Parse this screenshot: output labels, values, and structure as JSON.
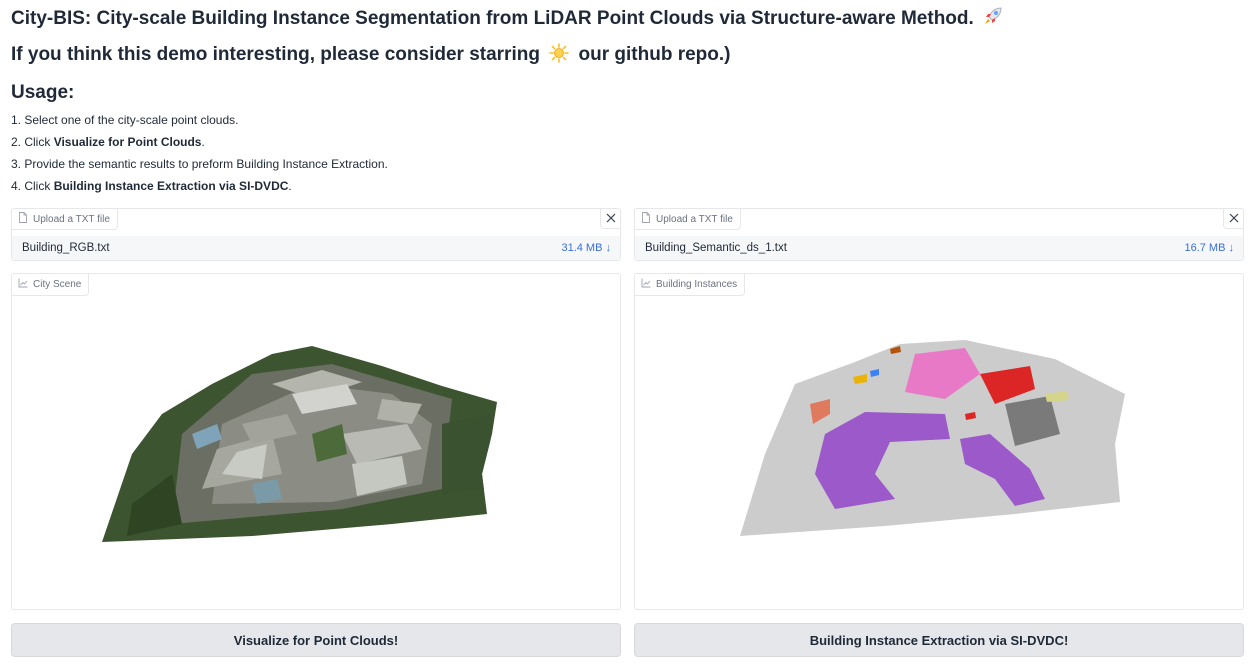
{
  "header": {
    "title": "City-BIS: City-scale Building Instance Segmentation from LiDAR Point Clouds via Structure-aware Method.",
    "title_icon": "rocket-icon",
    "star_text_before": "If you think this demo interesting, please consider starring",
    "star_icon": "sun-icon",
    "star_text_after": "our github repo.)",
    "usage_heading": "Usage:"
  },
  "steps": [
    {
      "prefix": "1. Select one of the city-scale point clouds.",
      "bold": "",
      "suffix": ""
    },
    {
      "prefix": "2. Click ",
      "bold": "Visualize for Point Clouds",
      "suffix": "."
    },
    {
      "prefix": "3. Provide the semantic results to preform Building Instance Extraction.",
      "bold": "",
      "suffix": ""
    },
    {
      "prefix": "4. Click ",
      "bold": "Building Instance Extraction via SI-DVDC",
      "suffix": "."
    }
  ],
  "left": {
    "upload_label": "Upload a TXT file",
    "file_name": "Building_RGB.txt",
    "file_size": "31.4 MB ↓",
    "plot_label": "City Scene",
    "button_label": "Visualize for Point Clouds!"
  },
  "right": {
    "upload_label": "Upload a TXT file",
    "file_name": "Building_Semantic_ds_1.txt",
    "file_size": "16.7 MB ↓",
    "plot_label": "Building Instances",
    "button_label": "Building Instance Extraction via SI-DVDC!"
  },
  "colors": {
    "link": "#3b6fd6",
    "button_bg": "#e5e7eb",
    "instance_pink": "#e879c6",
    "instance_red": "#dc2626",
    "instance_purple": "#9b59c9",
    "instance_gray": "#7a7a7a",
    "ground_gray": "#c8c8c8",
    "vegetation_green": "#2f4a22"
  }
}
